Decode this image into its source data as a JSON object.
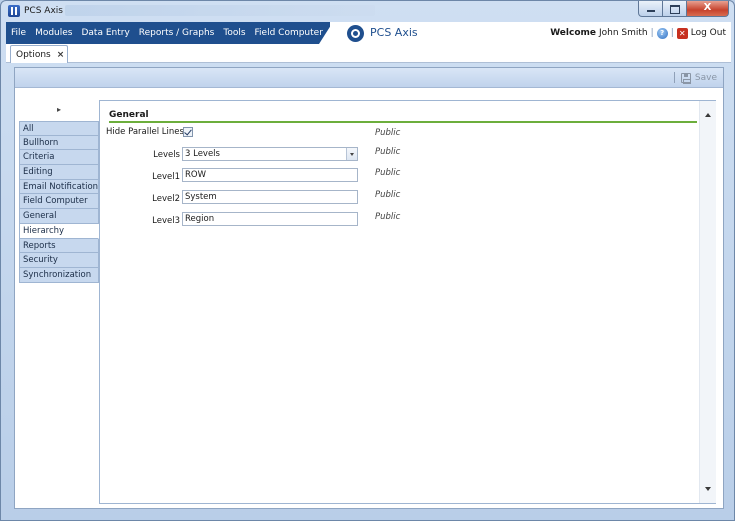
{
  "window": {
    "title": "PCS Axis",
    "controls": {
      "minimize": "minimize",
      "maximize": "maximize",
      "close": "X"
    }
  },
  "menu": {
    "items": [
      "File",
      "Modules",
      "Data Entry",
      "Reports / Graphs",
      "Tools",
      "Field Computer",
      "Help"
    ],
    "brand": "PCS Axis",
    "welcome_label": "Welcome",
    "user_name": "John Smith",
    "logout_label": "Log Out"
  },
  "tabs": [
    {
      "label": "Options",
      "close": "×"
    }
  ],
  "toolbar": {
    "save_label": "Save"
  },
  "sidebar": {
    "collapse_glyph": "▸",
    "items": [
      {
        "label": "All"
      },
      {
        "label": "Bullhorn"
      },
      {
        "label": "Criteria"
      },
      {
        "label": "Editing"
      },
      {
        "label": "Email Notification"
      },
      {
        "label": "Field Computer"
      },
      {
        "label": "General"
      },
      {
        "label": "Hierarchy"
      },
      {
        "label": "Reports"
      },
      {
        "label": "Security"
      },
      {
        "label": "Synchronization"
      }
    ],
    "active": "Hierarchy"
  },
  "panel": {
    "section_title": "General",
    "fields": {
      "hide_parallel_lines": {
        "label": "Hide Parallel Lines",
        "checked": true,
        "scope": "Public"
      },
      "levels": {
        "label": "Levels",
        "value": "3 Levels",
        "scope": "Public"
      },
      "level1": {
        "label": "Level1",
        "value": "ROW",
        "scope": "Public"
      },
      "level2": {
        "label": "Level2",
        "value": "System",
        "scope": "Public"
      },
      "level3": {
        "label": "Level3",
        "value": "Region",
        "scope": "Public"
      }
    }
  },
  "colors": {
    "menubar": "#1f4f8e",
    "accent_underline": "#6cae3c",
    "nav_background": "#c7d8ee"
  },
  "icons": [
    "app-icon",
    "brand-logo-icon",
    "help-icon",
    "logout-icon",
    "save-disk-icon",
    "checkmark-icon",
    "chevron-down-icon",
    "scroll-up-icon",
    "scroll-down-icon",
    "collapse-arrow-icon"
  ]
}
